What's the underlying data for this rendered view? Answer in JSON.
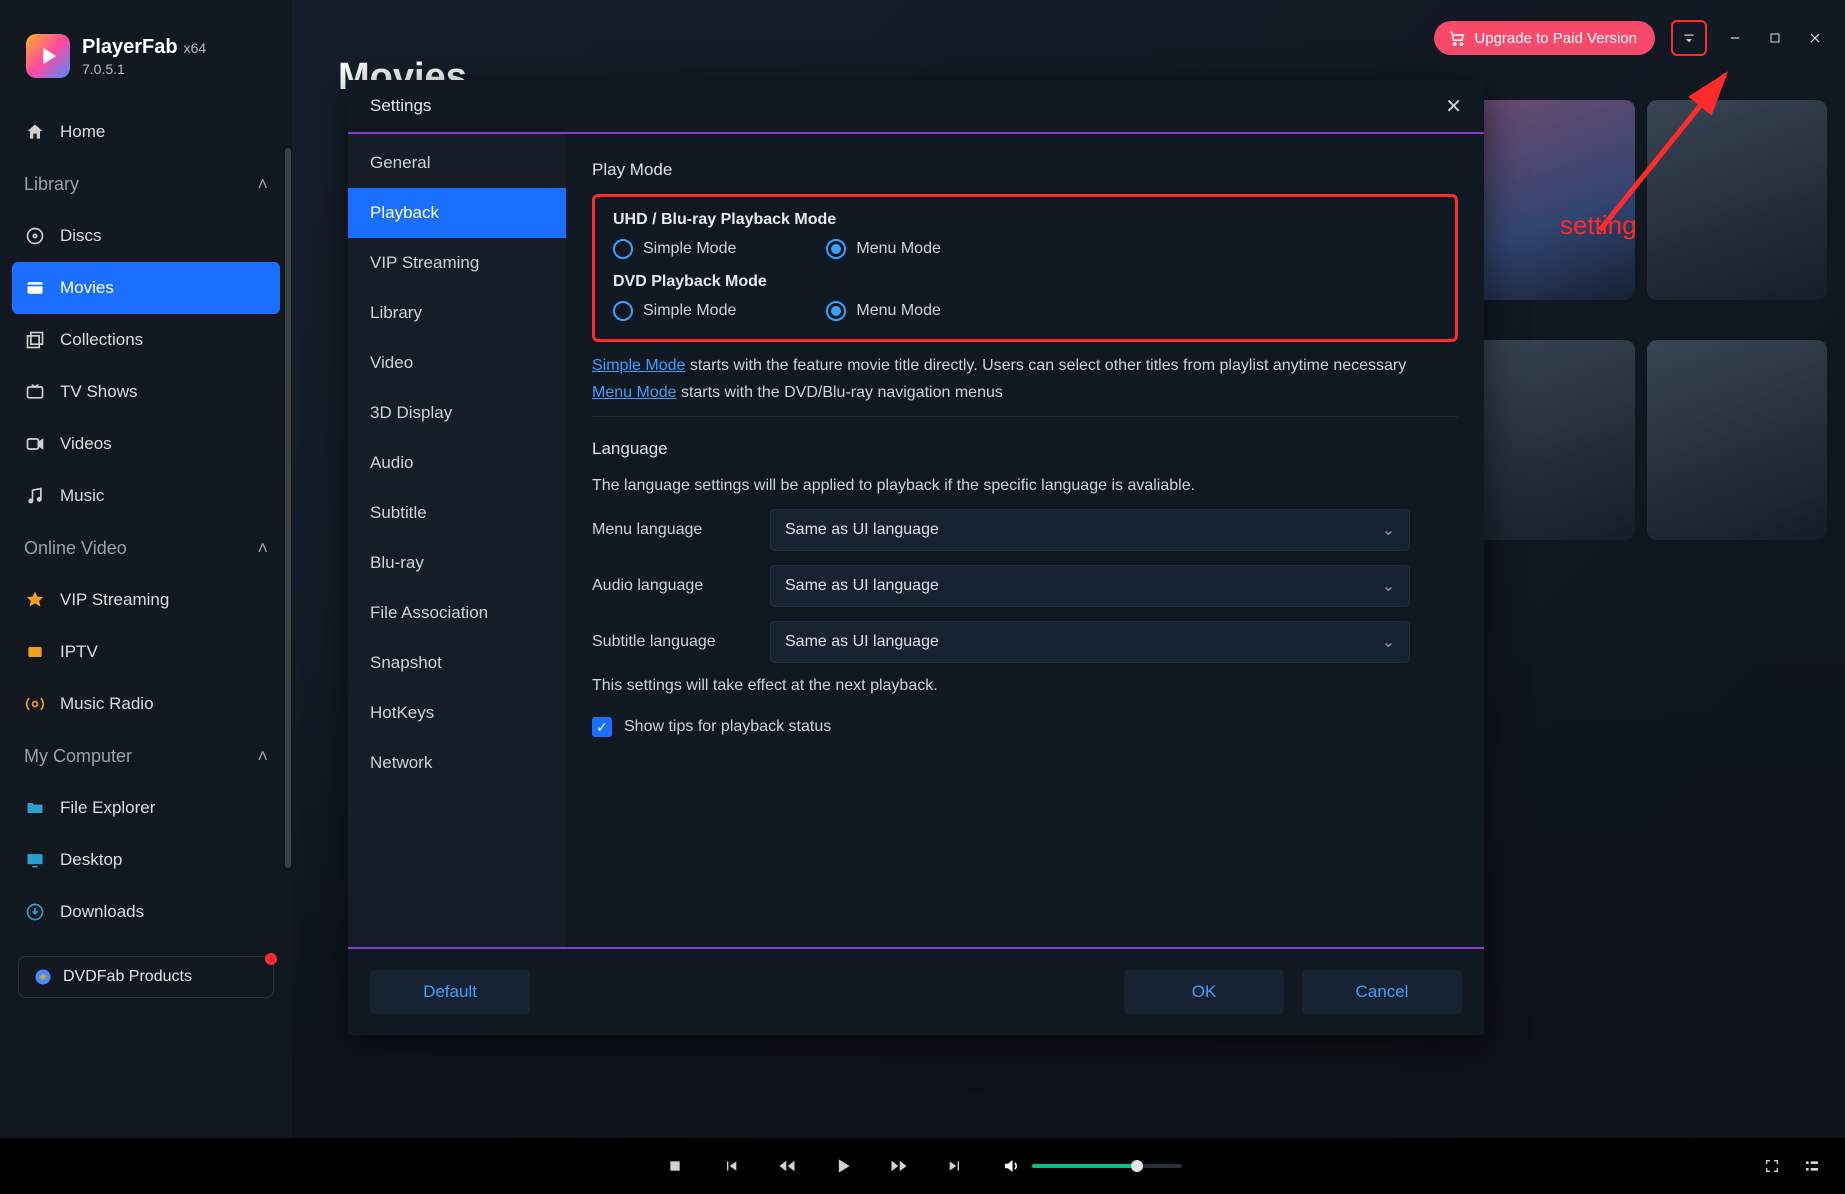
{
  "brand": {
    "name": "PlayerFab",
    "arch": "x64",
    "version": "7.0.5.1"
  },
  "topbar": {
    "upgrade_label": "Upgrade to Paid Version"
  },
  "callout": {
    "label": "setting"
  },
  "page_title": "Movies",
  "sidebar": {
    "home_label": "Home",
    "library_label": "Library",
    "library_items": [
      {
        "label": "Discs"
      },
      {
        "label": "Movies"
      },
      {
        "label": "Collections"
      },
      {
        "label": "TV Shows"
      },
      {
        "label": "Videos"
      },
      {
        "label": "Music"
      }
    ],
    "online_label": "Online Video",
    "online_items": [
      {
        "label": "VIP Streaming"
      },
      {
        "label": "IPTV"
      },
      {
        "label": "Music Radio"
      }
    ],
    "computer_label": "My Computer",
    "computer_items": [
      {
        "label": "File Explorer"
      },
      {
        "label": "Desktop"
      },
      {
        "label": "Downloads"
      }
    ],
    "products_label": "DVDFab Products"
  },
  "dialog": {
    "title": "Settings",
    "nav": [
      "General",
      "Playback",
      "VIP Streaming",
      "Library",
      "Video",
      "3D Display",
      "Audio",
      "Subtitle",
      "Blu-ray",
      "File Association",
      "Snapshot",
      "HotKeys",
      "Network"
    ],
    "playmode_title": "Play Mode",
    "uhd_title": "UHD / Blu-ray Playback Mode",
    "dvd_title": "DVD Playback Mode",
    "simple_label": "Simple Mode",
    "menu_label": "Menu Mode",
    "simple_link": "Simple Mode",
    "simple_desc": " starts with the feature movie title directly. Users can select other titles from playlist anytime necessary",
    "menu_link": "Menu Mode",
    "menu_desc": " starts with the DVD/Blu-ray navigation menus",
    "language_title": "Language",
    "language_note": "The language settings will be applied to playback if the specific language is avaliable.",
    "menu_lang_label": "Menu language",
    "audio_lang_label": "Audio language",
    "sub_lang_label": "Subtitle language",
    "lang_value": "Same as UI language",
    "effect_note": "This settings will take effect at the next playback.",
    "tips_label": "Show tips for playback status",
    "default_btn": "Default",
    "ok_btn": "OK",
    "cancel_btn": "Cancel"
  }
}
